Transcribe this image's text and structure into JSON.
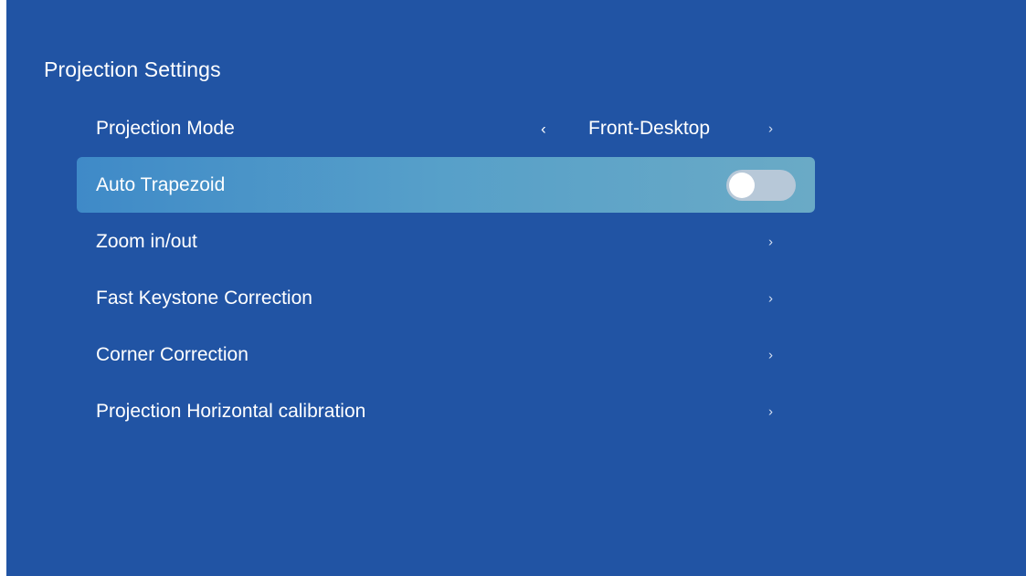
{
  "screen": {
    "title": "Projection Settings"
  },
  "menu": {
    "items": [
      {
        "label": "Projection Mode",
        "value": "Front-Desktop",
        "left_arrow": "‹",
        "right_arrow": "›"
      },
      {
        "label": "Auto Trapezoid",
        "toggle_on": false
      },
      {
        "label": "Zoom in/out",
        "right_arrow": "›"
      },
      {
        "label": "Fast Keystone Correction",
        "right_arrow": "›"
      },
      {
        "label": "Corner Correction",
        "right_arrow": "›"
      },
      {
        "label": "Projection Horizontal calibration",
        "right_arrow": "›"
      }
    ]
  },
  "colors": {
    "background": "#2154a4",
    "selected_row": "#57a0c9",
    "toggle_track": "#b7c8d8"
  }
}
